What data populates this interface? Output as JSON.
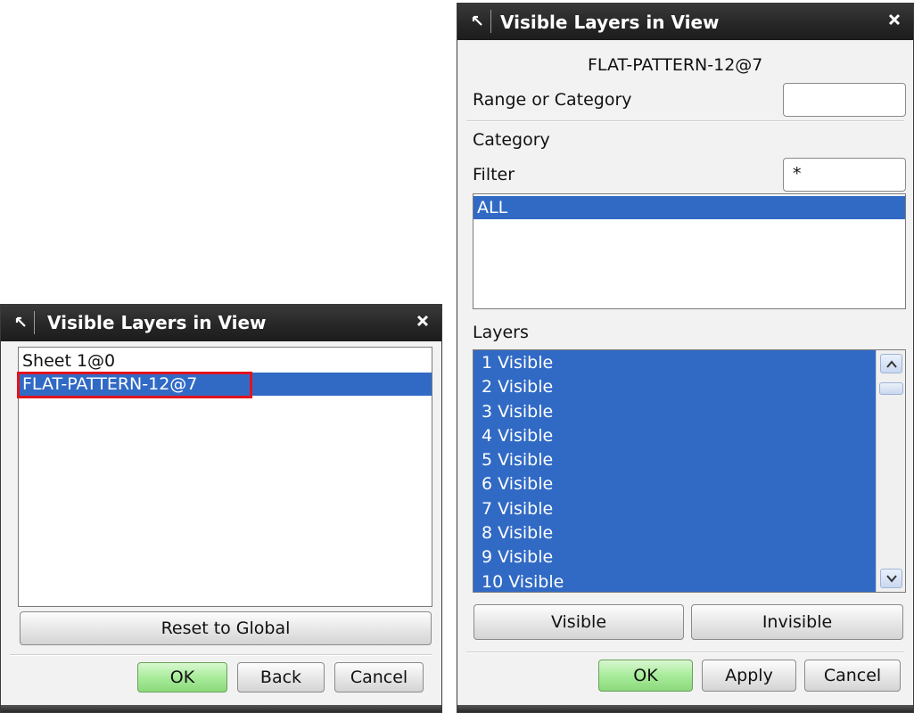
{
  "left_dialog": {
    "title": "Visible Layers in View",
    "views": [
      "Sheet 1@0",
      "FLAT-PATTERN-12@7"
    ],
    "reset_label": "Reset to Global",
    "ok_label": "OK",
    "back_label": "Back",
    "cancel_label": "Cancel"
  },
  "right_dialog": {
    "title": "Visible Layers in View",
    "view_name": "FLAT-PATTERN-12@7",
    "range_label": "Range or Category",
    "range_value": "",
    "category_label": "Category",
    "filter_label": "Filter",
    "filter_value": "*",
    "categories": [
      "ALL"
    ],
    "layers_label": "Layers",
    "layers": [
      "1 Visible",
      "2 Visible",
      "3 Visible",
      "4 Visible",
      "5 Visible",
      "6 Visible",
      "7 Visible",
      "8 Visible",
      "9 Visible",
      "10 Visible"
    ],
    "visible_label": "Visible",
    "invisible_label": "Invisible",
    "ok_label": "OK",
    "apply_label": "Apply",
    "cancel_label": "Cancel"
  },
  "colors": {
    "selection": "#316ac5",
    "titlebar": "#262626",
    "highlight": "#e0141e",
    "ok_green": "#a8ec9a"
  }
}
